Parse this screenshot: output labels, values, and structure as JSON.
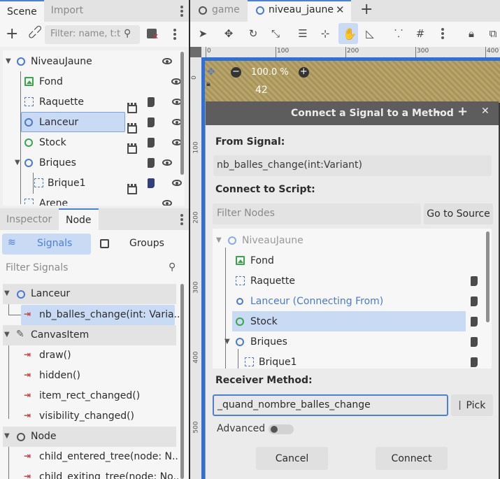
{
  "left_tabs": {
    "scene": "Scene",
    "import": "Import"
  },
  "scene_filter_placeholder": "Filter: name, t:t",
  "scene_tree": [
    {
      "label": "NiveauJaune"
    },
    {
      "label": "Fond"
    },
    {
      "label": "Raquette"
    },
    {
      "label": "Lanceur"
    },
    {
      "label": "Stock"
    },
    {
      "label": "Briques"
    },
    {
      "label": "Brique1"
    },
    {
      "label": "Arene"
    }
  ],
  "dock_tabs": {
    "inspector": "Inspector",
    "node": "Node"
  },
  "node_subtabs": {
    "signals": "Signals",
    "groups": "Groups"
  },
  "filter_signals_placeholder": "Filter Signals",
  "signals_tree": {
    "lanceur": "Lanceur",
    "nb_signal": "nb_balles_change(int: Varia...",
    "canvasitem": "CanvasItem",
    "draw": "draw()",
    "hidden": "hidden()",
    "item_rect": "item_rect_changed()",
    "visibility": "visibility_changed()",
    "node": "Node",
    "child_entered": "child_entered_tree(node: N...",
    "child_exiting": "child_exiting_tree(node: No..."
  },
  "editor_tabs": {
    "game": "game",
    "niveau": "niveau_jaune"
  },
  "ruler": {
    "r100": "100",
    "r200": "200",
    "r300": "300",
    "r400": "400",
    "v100": "100",
    "v200": "200",
    "v300": "300",
    "v400": "400",
    "v500": "500",
    "v0": "0"
  },
  "zoom": {
    "value": "100.0 %",
    "minus": "−",
    "plus": "+"
  },
  "viewport_number": "42",
  "dialog": {
    "title": "Connect a Signal to a Method",
    "from_signal_label": "From Signal:",
    "from_signal_value": "nb_balles_change(int:Variant)",
    "connect_script_label": "Connect to Script:",
    "filter_nodes_placeholder": "Filter Nodes",
    "go_to_source": "Go to Source",
    "tree": {
      "niveau": "NiveauJaune",
      "fond": "Fond",
      "raquette": "Raquette",
      "lanceur": "Lanceur (Connecting From)",
      "stock": "Stock",
      "briques": "Briques",
      "brique1": "Brique1"
    },
    "receiver_label": "Receiver Method:",
    "receiver_value": "_quand_nombre_balles_change",
    "pick": "Pick",
    "advanced": "Advanced",
    "cancel": "Cancel",
    "connect": "Connect"
  },
  "colors": {
    "accent": "#4d7fd6",
    "selected_bg": "#c9daf5",
    "signal_red": "#c8393b",
    "node_blue": "#4a78d4",
    "node_green": "#3aa54c",
    "link_blue": "#4a78d4"
  }
}
